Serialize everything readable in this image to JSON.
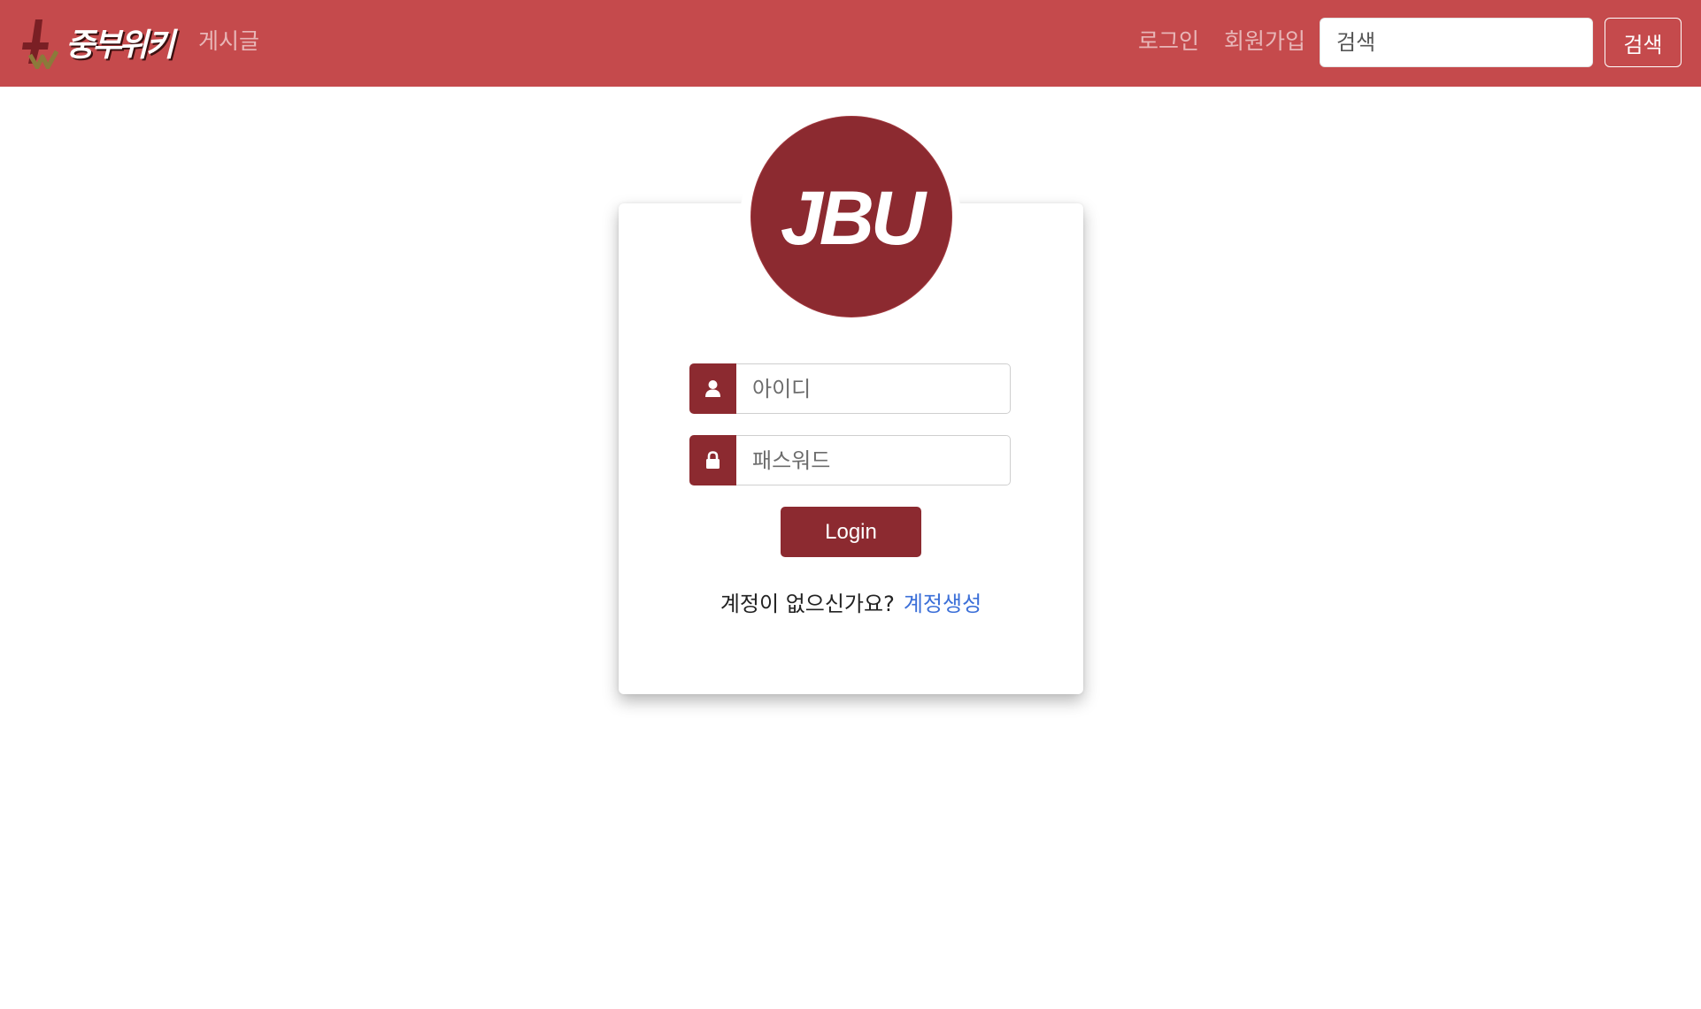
{
  "colors": {
    "navbar_bg": "#c54a4c",
    "brand_primary": "#8c2a30",
    "link": "#3b6fd8"
  },
  "navbar": {
    "brand_text": "중부위키",
    "posts_label": "게시글",
    "login_label": "로그인",
    "signup_label": "회원가입",
    "search_placeholder": "검색",
    "search_button_label": "검색"
  },
  "login_card": {
    "logo_text": "JBU",
    "username_placeholder": "아이디",
    "password_placeholder": "패스워드",
    "login_button_label": "Login",
    "no_account_text": "계정이 없으신가요?",
    "create_account_label": "계정생성",
    "username_icon": "user-icon",
    "password_icon": "lock-icon"
  }
}
